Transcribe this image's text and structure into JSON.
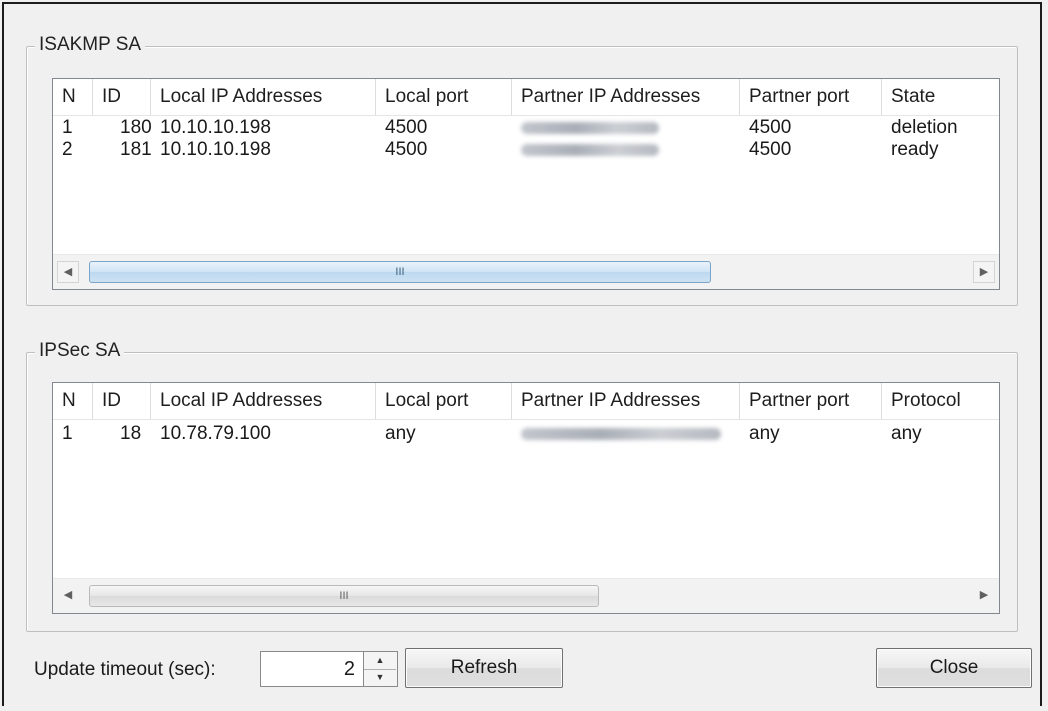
{
  "isakmp": {
    "title": "ISAKMP SA",
    "columns": [
      "N",
      "ID",
      "Local IP Addresses",
      "Local port",
      "Partner IP Addresses",
      "Partner port",
      "State"
    ],
    "rows": [
      {
        "n": "1",
        "id": "180",
        "local_ip": "10.10.10.198",
        "local_port": "4500",
        "partner_ip_redacted": true,
        "partner_port": "4500",
        "state": "deletion"
      },
      {
        "n": "2",
        "id": "181",
        "local_ip": "10.10.10.198",
        "local_port": "4500",
        "partner_ip_redacted": true,
        "partner_port": "4500",
        "state": "ready"
      }
    ],
    "scroll_thumb_glyph": "III",
    "scroll_left_glyph": "◀",
    "scroll_right_glyph": "▶"
  },
  "ipsec": {
    "title": "IPSec SA",
    "columns": [
      "N",
      "ID",
      "Local IP Addresses",
      "Local port",
      "Partner IP Addresses",
      "Partner port",
      "Protocol"
    ],
    "rows": [
      {
        "n": "1",
        "id": "18",
        "local_ip": "10.78.79.100",
        "local_port": "any",
        "partner_ip_redacted": true,
        "partner_port": "any",
        "protocol": "any"
      }
    ],
    "scroll_thumb_glyph": "III",
    "scroll_left_glyph": "◀",
    "scroll_right_glyph": "▶"
  },
  "footer": {
    "timeout_label": "Update timeout (sec):",
    "timeout_value": "2",
    "spin_up_glyph": "▲",
    "spin_down_glyph": "▼",
    "refresh_label": "Refresh",
    "close_label": "Close"
  }
}
